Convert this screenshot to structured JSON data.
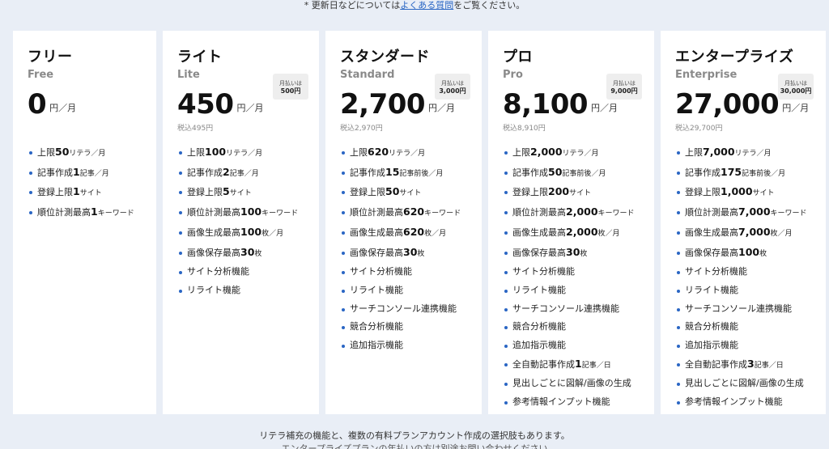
{
  "top_note": {
    "before": "* 更新日などについては",
    "link": "よくある質問",
    "after": "をご覧ください。"
  },
  "plans": [
    {
      "name": "フリー",
      "en": "Free",
      "price": "0",
      "per": "円／月",
      "tax": "",
      "annual_label": "",
      "annual_value": "",
      "features": [
        {
          "a": "上限",
          "n": "50",
          "b": "リテラ／月"
        },
        {
          "a": "記事作成",
          "n": "1",
          "b": "記事／月"
        },
        {
          "a": "登録上限",
          "n": "1",
          "b": "サイト"
        },
        {
          "a": "順位計測最高",
          "n": "1",
          "b": "キーワード"
        }
      ]
    },
    {
      "name": "ライト",
      "en": "Lite",
      "price": "450",
      "per": "円／月",
      "tax": "税込495円",
      "annual_label": "月払いは",
      "annual_value": "500円",
      "features": [
        {
          "a": "上限",
          "n": "100",
          "b": "リテラ／月"
        },
        {
          "a": "記事作成",
          "n": "2",
          "b": "記事／月"
        },
        {
          "a": "登録上限",
          "n": "5",
          "b": "サイト"
        },
        {
          "a": "順位計測最高",
          "n": "100",
          "b": "キーワード"
        },
        {
          "a": "画像生成最高",
          "n": "100",
          "b": "枚／月"
        },
        {
          "a": "画像保存最高",
          "n": "30",
          "b": "枚"
        },
        {
          "a": "サイト分析機能",
          "n": "",
          "b": ""
        },
        {
          "a": "リライト機能",
          "n": "",
          "b": ""
        }
      ]
    },
    {
      "name": "スタンダード",
      "en": "Standard",
      "price": "2,700",
      "per": "円／月",
      "tax": "税込2,970円",
      "annual_label": "月払いは",
      "annual_value": "3,000円",
      "features": [
        {
          "a": "上限",
          "n": "620",
          "b": "リテラ／月"
        },
        {
          "a": "記事作成",
          "n": "15",
          "b": "記事前後／月"
        },
        {
          "a": "登録上限",
          "n": "50",
          "b": "サイト"
        },
        {
          "a": "順位計測最高",
          "n": "620",
          "b": "キーワード"
        },
        {
          "a": "画像生成最高",
          "n": "620",
          "b": "枚／月"
        },
        {
          "a": "画像保存最高",
          "n": "30",
          "b": "枚"
        },
        {
          "a": "サイト分析機能",
          "n": "",
          "b": ""
        },
        {
          "a": "リライト機能",
          "n": "",
          "b": ""
        },
        {
          "a": "サーチコンソール連携機能",
          "n": "",
          "b": ""
        },
        {
          "a": "競合分析機能",
          "n": "",
          "b": ""
        },
        {
          "a": "追加指示機能",
          "n": "",
          "b": ""
        }
      ]
    },
    {
      "name": "プロ",
      "en": "Pro",
      "price": "8,100",
      "per": "円／月",
      "tax": "税込8,910円",
      "annual_label": "月払いは",
      "annual_value": "9,000円",
      "features": [
        {
          "a": "上限",
          "n": "2,000",
          "b": "リテラ／月"
        },
        {
          "a": "記事作成",
          "n": "50",
          "b": "記事前後／月"
        },
        {
          "a": "登録上限",
          "n": "200",
          "b": "サイト"
        },
        {
          "a": "順位計測最高",
          "n": "2,000",
          "b": "キーワード"
        },
        {
          "a": "画像生成最高",
          "n": "2,000",
          "b": "枚／月"
        },
        {
          "a": "画像保存最高",
          "n": "30",
          "b": "枚"
        },
        {
          "a": "サイト分析機能",
          "n": "",
          "b": ""
        },
        {
          "a": "リライト機能",
          "n": "",
          "b": ""
        },
        {
          "a": "サーチコンソール連携機能",
          "n": "",
          "b": ""
        },
        {
          "a": "競合分析機能",
          "n": "",
          "b": ""
        },
        {
          "a": "追加指示機能",
          "n": "",
          "b": ""
        },
        {
          "a": "全自動記事作成",
          "n": "1",
          "b": "記事／日"
        },
        {
          "a": "見出しごとに図解/画像の生成",
          "n": "",
          "b": ""
        },
        {
          "a": "参考情報インプット機能",
          "n": "",
          "b": ""
        }
      ]
    },
    {
      "name": "エンタープライズ",
      "en": "Enterprise",
      "price": "27,000",
      "per": "円／月",
      "tax": "税込29,700円",
      "annual_label": "月払いは",
      "annual_value": "30,000円",
      "features": [
        {
          "a": "上限",
          "n": "7,000",
          "b": "リテラ／月"
        },
        {
          "a": "記事作成",
          "n": "175",
          "b": "記事前後／月"
        },
        {
          "a": "登録上限",
          "n": "1,000",
          "b": "サイト"
        },
        {
          "a": "順位計測最高",
          "n": "7,000",
          "b": "キーワード"
        },
        {
          "a": "画像生成最高",
          "n": "7,000",
          "b": "枚／月"
        },
        {
          "a": "画像保存最高",
          "n": "100",
          "b": "枚"
        },
        {
          "a": "サイト分析機能",
          "n": "",
          "b": ""
        },
        {
          "a": "リライト機能",
          "n": "",
          "b": ""
        },
        {
          "a": "サーチコンソール連携機能",
          "n": "",
          "b": ""
        },
        {
          "a": "競合分析機能",
          "n": "",
          "b": ""
        },
        {
          "a": "追加指示機能",
          "n": "",
          "b": ""
        },
        {
          "a": "全自動記事作成",
          "n": "3",
          "b": "記事／日"
        },
        {
          "a": "見出しごとに図解/画像の生成",
          "n": "",
          "b": ""
        },
        {
          "a": "参考情報インプット機能",
          "n": "",
          "b": ""
        }
      ]
    }
  ],
  "bottom_note": "リテラ補充の機能と、複数の有料プランアカウント作成の選択肢もあります。",
  "bottom_note2": "エンタープライズプランの年払いの方は別途お問い合わせください"
}
